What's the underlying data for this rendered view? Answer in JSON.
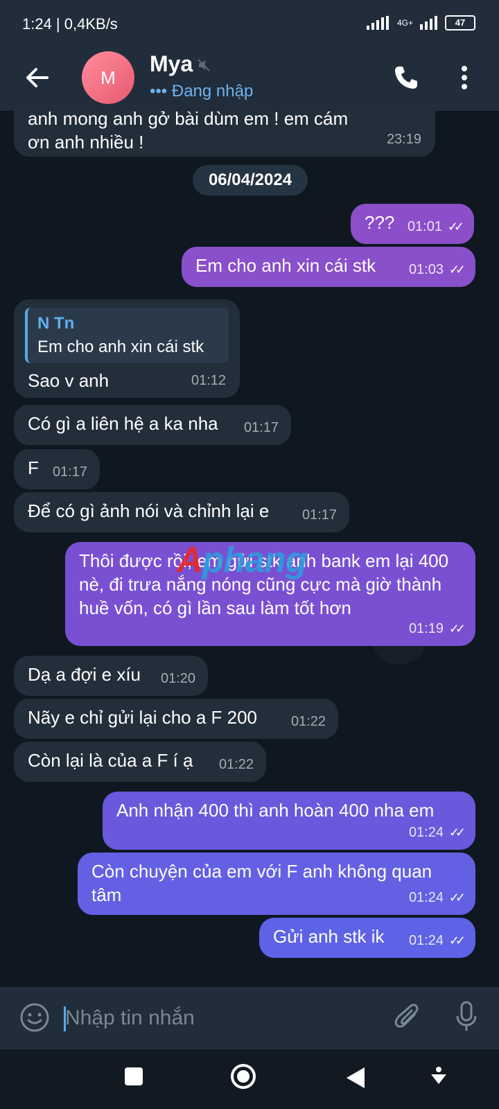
{
  "status_bar": {
    "time": "1:24 | 0,4KB/s",
    "battery": "47",
    "network": "4G+"
  },
  "header": {
    "avatar_letter": "M",
    "name": "Mya",
    "status": "••• Đang nhập"
  },
  "messages": {
    "m0": {
      "text": "anh mong anh gở bài dùm em ! em cám ơn anh nhiều !",
      "time": "23:19"
    },
    "date": "06/04/2024",
    "m1": {
      "text": "???",
      "time": "01:01"
    },
    "m2": {
      "text": "Em cho anh xin cái stk",
      "time": "01:03"
    },
    "m3": {
      "reply_name": "N Tn",
      "reply_text": "Em cho anh xin cái stk",
      "text": "Sao v anh",
      "time": "01:12"
    },
    "m4": {
      "text": "Có gì a liên hệ a ka nha",
      "time": "01:17"
    },
    "m5": {
      "text": "F",
      "time": "01:17"
    },
    "m6": {
      "text": "Để có gì ảnh nói và chỉnh lại e",
      "time": "01:17"
    },
    "m7": {
      "text": "Thôi được rồi, em gửi stk anh bank em lại 400 nè, đi trưa nắng nóng cũng cực mà giờ thành huề vốn, có gì lần sau làm tốt hơn",
      "time": "01:19"
    },
    "m8": {
      "text": "Dạ a đợi e xíu",
      "time": "01:20"
    },
    "m9": {
      "text": "Nãy e chỉ gửi lại cho a F 200",
      "time": "01:22"
    },
    "m10": {
      "text": "Còn lại là của a F í ạ",
      "time": "01:22"
    },
    "m11": {
      "text": "Anh nhận 400 thì anh hoàn 400 nha em",
      "time": "01:24"
    },
    "m12": {
      "text": "Còn chuyện của em với F anh không quan tâm",
      "time": "01:24"
    },
    "m13": {
      "text": "Gửi anh stk ik",
      "time": "01:24"
    }
  },
  "input": {
    "placeholder": "Nhập tin nhắn"
  },
  "watermark": {
    "a": "A",
    "rest": "phang"
  },
  "colors": {
    "outgoing_top": "#8f4fc8",
    "outgoing_bottom": "#5b62e6",
    "incoming": "#222e3a",
    "accent": "#5aa9ec"
  },
  "icons": [
    "back-arrow-icon",
    "mute-icon",
    "phone-icon",
    "more-vertical-icon",
    "emoji-icon",
    "attach-icon",
    "mic-icon",
    "double-check-icon"
  ]
}
